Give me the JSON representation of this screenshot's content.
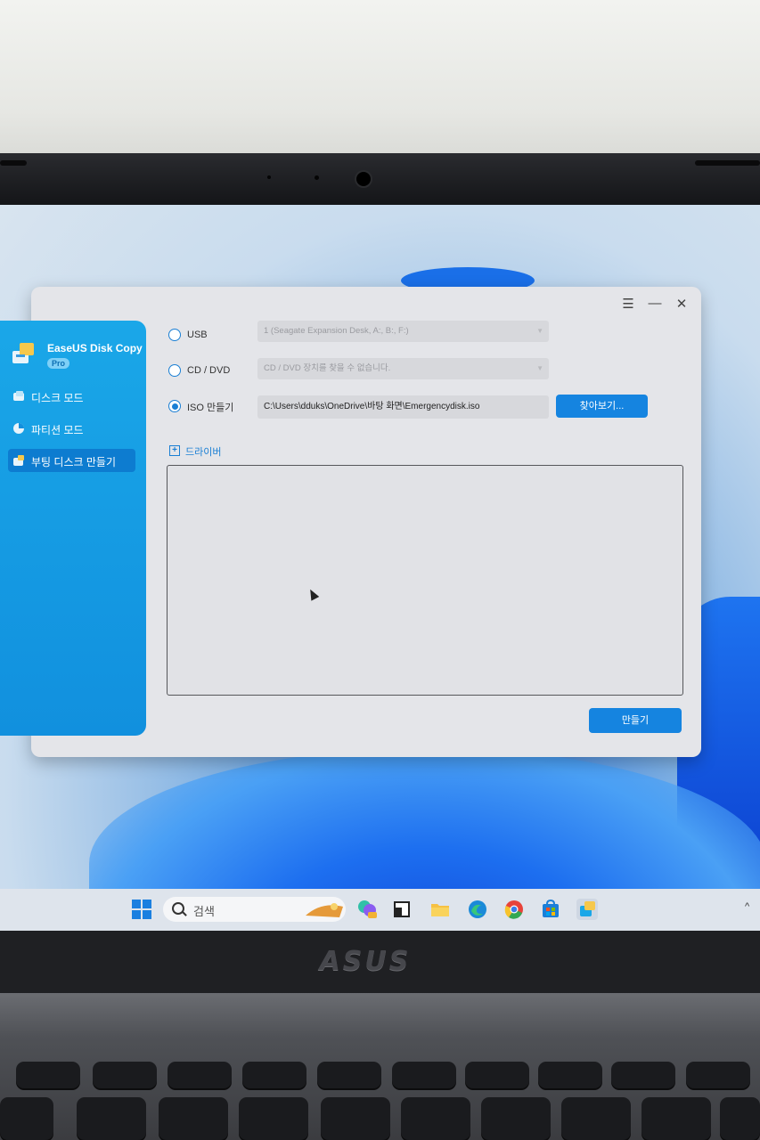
{
  "app": {
    "name": "EaseUS Disk Copy",
    "badge": "Pro"
  },
  "window_controls": {
    "menu": "☰",
    "minimize": "—",
    "close": "✕"
  },
  "sidebar": {
    "items": [
      {
        "label": "디스크 모드",
        "icon": "disk-icon",
        "active": false
      },
      {
        "label": "파티션 모드",
        "icon": "partition-pie-icon",
        "active": false
      },
      {
        "label": "부팅 디스크 만들기",
        "icon": "boot-disk-icon",
        "active": true
      }
    ]
  },
  "options": {
    "usb": {
      "label": "USB",
      "selected": false,
      "value": "1 (Seagate Expansion Desk, A:, B:, F:)"
    },
    "cd_dvd": {
      "label": "CD / DVD",
      "selected": false,
      "value": "CD / DVD 장치를 찾을 수 없습니다."
    },
    "iso": {
      "label": "ISO 만들기",
      "selected": true,
      "path": "C:\\Users\\dduks\\OneDrive\\바탕 화면\\Emergencydisk.iso"
    }
  },
  "browse_button": "찾아보기...",
  "driver": {
    "toggle": "+",
    "label": "드라이버"
  },
  "create_button": "만들기",
  "taskbar": {
    "search_label": "검색",
    "chevron": "^"
  },
  "hardware": {
    "brand": "ASUS"
  },
  "colors": {
    "accent": "#1584e0",
    "sidebar": "#1aa7e8"
  }
}
